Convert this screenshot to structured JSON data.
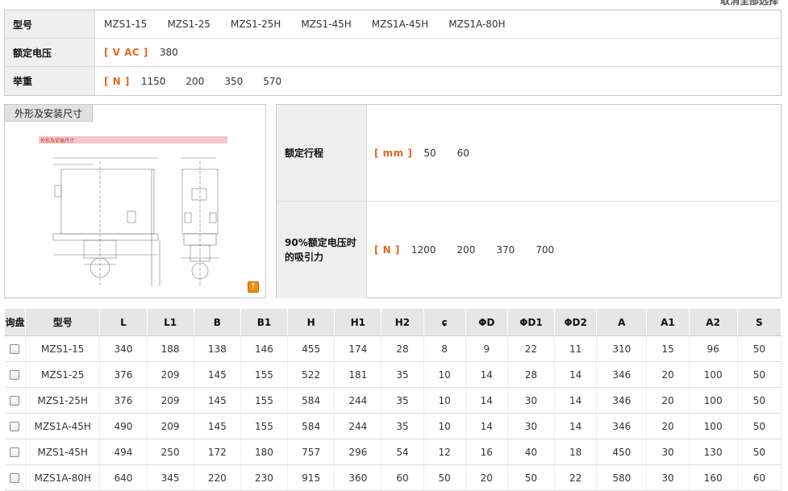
{
  "top_link": "取消全部选择",
  "spec": {
    "model_label": "型号",
    "models": [
      "MZS1-15",
      "MZS1-25",
      "MZS1-25H",
      "MZS1-45H",
      "MZS1A-45H",
      "MZS1A-80H"
    ],
    "voltage_label": "额定电压",
    "voltage_unit": "[ V AC ]",
    "voltage_values": [
      "380"
    ],
    "lift_label": "举重",
    "lift_unit": "[  N  ]",
    "lift_values": [
      "1150",
      "200",
      "350",
      "570"
    ]
  },
  "drawing": {
    "tab_label": "外形及安装尺寸",
    "image_caption": "外形及安装尺寸",
    "zoom_icon": "zoom-icon"
  },
  "extra": {
    "stroke_label": "额定行程",
    "stroke_unit": "[ mm ]",
    "stroke_values": [
      "50",
      "60"
    ],
    "force_label": "90%额定电压时的吸引力",
    "force_unit": "[  N  ]",
    "force_values": [
      "1200",
      "200",
      "370",
      "700"
    ]
  },
  "table": {
    "headers": [
      "询盘",
      "型号",
      "L",
      "L1",
      "B",
      "B1",
      "H",
      "H1",
      "H2",
      "ɕ",
      "ΦD",
      "ΦD1",
      "ΦD2",
      "A",
      "A1",
      "A2",
      "S"
    ],
    "rows": [
      [
        "MZS1-15",
        "340",
        "188",
        "138",
        "146",
        "455",
        "174",
        "28",
        "8",
        "9",
        "22",
        "11",
        "310",
        "15",
        "96",
        "50"
      ],
      [
        "MZS1-25",
        "376",
        "209",
        "145",
        "155",
        "522",
        "181",
        "35",
        "10",
        "14",
        "28",
        "14",
        "346",
        "20",
        "100",
        "50"
      ],
      [
        "MZS1-25H",
        "376",
        "209",
        "145",
        "155",
        "584",
        "244",
        "35",
        "10",
        "14",
        "30",
        "14",
        "346",
        "20",
        "100",
        "50"
      ],
      [
        "MZS1A-45H",
        "490",
        "209",
        "145",
        "155",
        "584",
        "244",
        "35",
        "10",
        "14",
        "30",
        "14",
        "346",
        "20",
        "100",
        "50"
      ],
      [
        "MZS1-45H",
        "494",
        "250",
        "172",
        "180",
        "757",
        "296",
        "54",
        "12",
        "16",
        "40",
        "18",
        "450",
        "30",
        "130",
        "50"
      ],
      [
        "MZS1A-80H",
        "640",
        "345",
        "220",
        "230",
        "915",
        "360",
        "60",
        "50",
        "20",
        "50",
        "22",
        "580",
        "30",
        "160",
        "60"
      ]
    ]
  }
}
